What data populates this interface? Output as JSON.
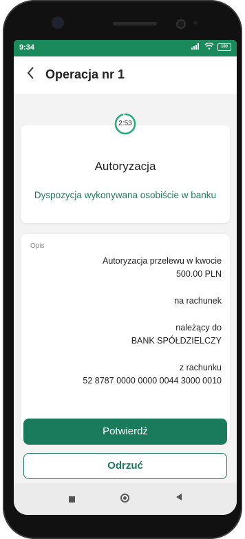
{
  "status_bar": {
    "time": "9:34",
    "signal": "📶",
    "wifi": "≋",
    "battery": "100"
  },
  "header": {
    "back_icon": "‹",
    "title": "Operacja nr 1"
  },
  "auth": {
    "timer": "2:53",
    "timer_fraction_remaining": 0.95,
    "title": "Autoryzacja",
    "note": "Dyspozycja wykonywana osobiście w banku"
  },
  "details": {
    "label": "Opis",
    "lines": [
      "Autoryzacja przelewu w kwocie",
      "500.00 PLN",
      "",
      "na rachunek",
      "",
      "należący do",
      "BANK SPÓŁDZIELCZY",
      "",
      "z rachunku",
      "52 8787 0000 0000 0044 3000 0010"
    ]
  },
  "buttons": {
    "confirm": "Potwierdź",
    "reject": "Odrzuć"
  },
  "colors": {
    "accent": "#1a7a5c",
    "status_bar": "#1a8a5a"
  }
}
